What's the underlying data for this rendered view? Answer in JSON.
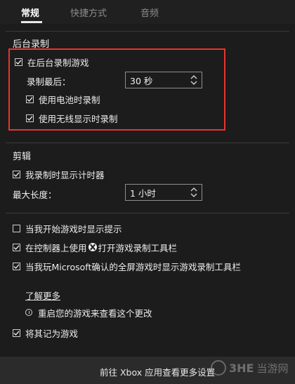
{
  "tabs": [
    {
      "label": "常规",
      "active": true
    },
    {
      "label": "快捷方式",
      "active": false
    },
    {
      "label": "音频",
      "active": false
    }
  ],
  "background_recording": {
    "title": "后台录制",
    "record_in_background": {
      "label": "在后台录制游戏",
      "checked": true
    },
    "record_last_label": "录制最后：",
    "record_last_value": "30 秒",
    "on_battery": {
      "label": "使用电池时录制",
      "checked": true
    },
    "on_wireless_display": {
      "label": "使用无线显示时录制",
      "checked": true
    }
  },
  "clips": {
    "title": "剪辑",
    "show_timer": {
      "label": "我录制时显示计时器",
      "checked": true
    },
    "max_length_label": "最大长度：",
    "max_length_value": "1 小时"
  },
  "options": {
    "show_tips": {
      "label": "当我开始游戏时显示提示",
      "checked": false
    },
    "controller_pre": "在控制器上使用",
    "controller_post": "打开游戏录制工具栏",
    "controller_checked": true,
    "fullscreen_toolbar": {
      "label": "当我玩Microsoft确认的全屏游戏时显示游戏录制工具栏",
      "checked": true
    }
  },
  "learn_more": "了解更多",
  "restart_notice": "重启您的游戏来查看这个更改",
  "remember_as_game": {
    "label": "将其记为游戏",
    "checked": true
  },
  "footer": {
    "text": "前往 Xbox 应用查看更多设置"
  },
  "watermark": {
    "brand": "3HE",
    "name": "当游网"
  },
  "colors": {
    "background": "#1c1c1c",
    "highlight": "#e8342f",
    "footer": "#2b2b2b"
  }
}
